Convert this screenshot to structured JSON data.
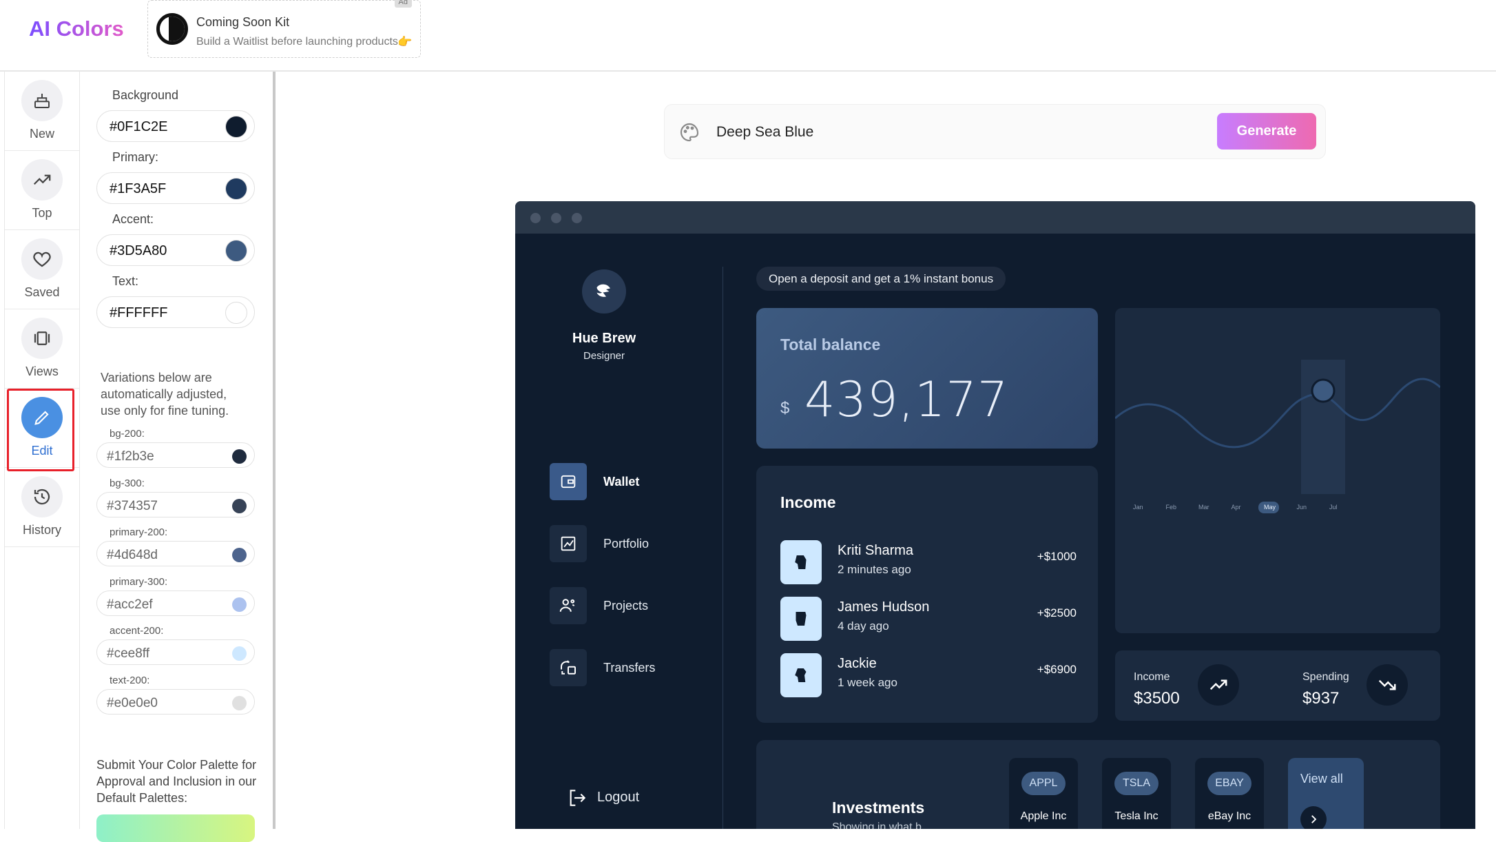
{
  "header": {
    "logo": "AI Colors",
    "ad": {
      "title": "Coming Soon Kit",
      "subtitle": "Build a Waitlist before launching products.",
      "badge": "Ad"
    }
  },
  "rail": {
    "items": [
      {
        "label": "New",
        "icon": "stack-icon"
      },
      {
        "label": "Top",
        "icon": "trending-icon"
      },
      {
        "label": "Saved",
        "icon": "heart-icon"
      },
      {
        "label": "Views",
        "icon": "carousel-icon"
      },
      {
        "label": "Edit",
        "icon": "pencil-icon",
        "active": true
      },
      {
        "label": "History",
        "icon": "history-icon"
      }
    ]
  },
  "editor": {
    "fields": [
      {
        "label": "Background",
        "value": "#0F1C2E",
        "color": "#0F1C2E"
      },
      {
        "label": "Primary:",
        "value": "#1F3A5F",
        "color": "#1F3A5F"
      },
      {
        "label": "Accent:",
        "value": "#3D5A80",
        "color": "#3D5A80"
      },
      {
        "label": "Text:",
        "value": "#FFFFFF",
        "color": "#FFFFFF"
      }
    ],
    "variation_note": "Variations below are automatically adjusted, use only for fine tuning.",
    "variations": [
      {
        "label": "bg-200:",
        "value": "#1f2b3e",
        "color": "#1f2b3e"
      },
      {
        "label": "bg-300:",
        "value": "#374357",
        "color": "#374357"
      },
      {
        "label": "primary-200:",
        "value": "#4d648d",
        "color": "#4d648d"
      },
      {
        "label": "primary-300:",
        "value": "#acc2ef",
        "color": "#acc2ef"
      },
      {
        "label": "accent-200:",
        "value": "#cee8ff",
        "color": "#cee8ff"
      },
      {
        "label": "text-200:",
        "value": "#e0e0e0",
        "color": "#e0e0e0"
      }
    ],
    "submit_note": "Submit Your Color Palette for Approval and Inclusion in our Default Palettes:"
  },
  "prompt": {
    "value": "Deep Sea Blue",
    "generate_label": "Generate"
  },
  "preview": {
    "user": {
      "name": "Hue Brew",
      "role": "Designer"
    },
    "nav": [
      {
        "label": "Wallet",
        "active": true,
        "icon": "wallet-icon"
      },
      {
        "label": "Portfolio",
        "icon": "chart-icon"
      },
      {
        "label": "Projects",
        "icon": "team-icon"
      },
      {
        "label": "Transfers",
        "icon": "transfer-icon"
      }
    ],
    "logout_label": "Logout",
    "promo": "Open a deposit and get a 1% instant bonus",
    "balance": {
      "title": "Total balance",
      "currency": "$",
      "value": "439,177"
    },
    "income": {
      "title": "Income",
      "rows": [
        {
          "name": "Kriti Sharma",
          "time": "2 minutes ago",
          "amount": "+$1000"
        },
        {
          "name": "James Hudson",
          "time": "4 day ago",
          "amount": "+$2500"
        },
        {
          "name": "Jackie",
          "time": "1 week ago",
          "amount": "+$6900"
        }
      ]
    },
    "chart": {
      "months": [
        "Jan",
        "Feb",
        "Mar",
        "Apr",
        "May",
        "Jun",
        "Jul"
      ],
      "selected": "May"
    },
    "stats": {
      "income_label": "Income",
      "income_value": "$3500",
      "spending_label": "Spending",
      "spending_value": "$937"
    },
    "investments": {
      "title": "Investments",
      "subtitle": "Showing in what b...",
      "tickers": [
        {
          "symbol": "APPL",
          "name": "Apple Inc"
        },
        {
          "symbol": "TSLA",
          "name": "Tesla Inc"
        },
        {
          "symbol": "EBAY",
          "name": "eBay Inc"
        }
      ],
      "view_all": "View all"
    }
  }
}
